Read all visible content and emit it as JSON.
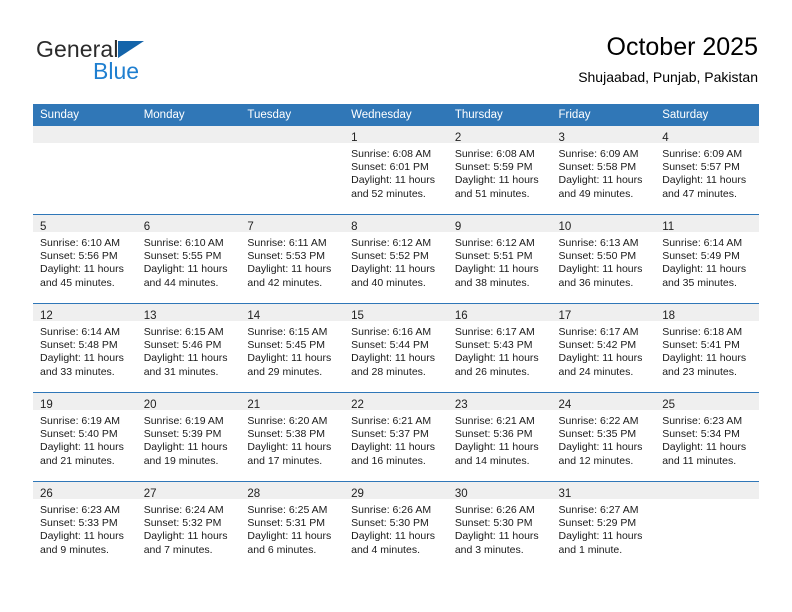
{
  "brand": {
    "name_top": "General",
    "name_bottom": "Blue",
    "triangle_color": "#1464aa",
    "blue_text_color": "#1f7fd0"
  },
  "header": {
    "title": "October 2025",
    "subtitle": "Shujaabad, Punjab, Pakistan",
    "accent_color": "#3077b7",
    "band_color": "#efefef"
  },
  "calendar": {
    "weekday_headers": [
      "Sunday",
      "Monday",
      "Tuesday",
      "Wednesday",
      "Thursday",
      "Friday",
      "Saturday"
    ],
    "weeks": [
      [
        {
          "day": "",
          "empty": true
        },
        {
          "day": "",
          "empty": true
        },
        {
          "day": "",
          "empty": true
        },
        {
          "day": "1",
          "sunrise": "Sunrise: 6:08 AM",
          "sunset": "Sunset: 6:01 PM",
          "daylight1": "Daylight: 11 hours",
          "daylight2": "and 52 minutes."
        },
        {
          "day": "2",
          "sunrise": "Sunrise: 6:08 AM",
          "sunset": "Sunset: 5:59 PM",
          "daylight1": "Daylight: 11 hours",
          "daylight2": "and 51 minutes."
        },
        {
          "day": "3",
          "sunrise": "Sunrise: 6:09 AM",
          "sunset": "Sunset: 5:58 PM",
          "daylight1": "Daylight: 11 hours",
          "daylight2": "and 49 minutes."
        },
        {
          "day": "4",
          "sunrise": "Sunrise: 6:09 AM",
          "sunset": "Sunset: 5:57 PM",
          "daylight1": "Daylight: 11 hours",
          "daylight2": "and 47 minutes."
        }
      ],
      [
        {
          "day": "5",
          "sunrise": "Sunrise: 6:10 AM",
          "sunset": "Sunset: 5:56 PM",
          "daylight1": "Daylight: 11 hours",
          "daylight2": "and 45 minutes."
        },
        {
          "day": "6",
          "sunrise": "Sunrise: 6:10 AM",
          "sunset": "Sunset: 5:55 PM",
          "daylight1": "Daylight: 11 hours",
          "daylight2": "and 44 minutes."
        },
        {
          "day": "7",
          "sunrise": "Sunrise: 6:11 AM",
          "sunset": "Sunset: 5:53 PM",
          "daylight1": "Daylight: 11 hours",
          "daylight2": "and 42 minutes."
        },
        {
          "day": "8",
          "sunrise": "Sunrise: 6:12 AM",
          "sunset": "Sunset: 5:52 PM",
          "daylight1": "Daylight: 11 hours",
          "daylight2": "and 40 minutes."
        },
        {
          "day": "9",
          "sunrise": "Sunrise: 6:12 AM",
          "sunset": "Sunset: 5:51 PM",
          "daylight1": "Daylight: 11 hours",
          "daylight2": "and 38 minutes."
        },
        {
          "day": "10",
          "sunrise": "Sunrise: 6:13 AM",
          "sunset": "Sunset: 5:50 PM",
          "daylight1": "Daylight: 11 hours",
          "daylight2": "and 36 minutes."
        },
        {
          "day": "11",
          "sunrise": "Sunrise: 6:14 AM",
          "sunset": "Sunset: 5:49 PM",
          "daylight1": "Daylight: 11 hours",
          "daylight2": "and 35 minutes."
        }
      ],
      [
        {
          "day": "12",
          "sunrise": "Sunrise: 6:14 AM",
          "sunset": "Sunset: 5:48 PM",
          "daylight1": "Daylight: 11 hours",
          "daylight2": "and 33 minutes."
        },
        {
          "day": "13",
          "sunrise": "Sunrise: 6:15 AM",
          "sunset": "Sunset: 5:46 PM",
          "daylight1": "Daylight: 11 hours",
          "daylight2": "and 31 minutes."
        },
        {
          "day": "14",
          "sunrise": "Sunrise: 6:15 AM",
          "sunset": "Sunset: 5:45 PM",
          "daylight1": "Daylight: 11 hours",
          "daylight2": "and 29 minutes."
        },
        {
          "day": "15",
          "sunrise": "Sunrise: 6:16 AM",
          "sunset": "Sunset: 5:44 PM",
          "daylight1": "Daylight: 11 hours",
          "daylight2": "and 28 minutes."
        },
        {
          "day": "16",
          "sunrise": "Sunrise: 6:17 AM",
          "sunset": "Sunset: 5:43 PM",
          "daylight1": "Daylight: 11 hours",
          "daylight2": "and 26 minutes."
        },
        {
          "day": "17",
          "sunrise": "Sunrise: 6:17 AM",
          "sunset": "Sunset: 5:42 PM",
          "daylight1": "Daylight: 11 hours",
          "daylight2": "and 24 minutes."
        },
        {
          "day": "18",
          "sunrise": "Sunrise: 6:18 AM",
          "sunset": "Sunset: 5:41 PM",
          "daylight1": "Daylight: 11 hours",
          "daylight2": "and 23 minutes."
        }
      ],
      [
        {
          "day": "19",
          "sunrise": "Sunrise: 6:19 AM",
          "sunset": "Sunset: 5:40 PM",
          "daylight1": "Daylight: 11 hours",
          "daylight2": "and 21 minutes."
        },
        {
          "day": "20",
          "sunrise": "Sunrise: 6:19 AM",
          "sunset": "Sunset: 5:39 PM",
          "daylight1": "Daylight: 11 hours",
          "daylight2": "and 19 minutes."
        },
        {
          "day": "21",
          "sunrise": "Sunrise: 6:20 AM",
          "sunset": "Sunset: 5:38 PM",
          "daylight1": "Daylight: 11 hours",
          "daylight2": "and 17 minutes."
        },
        {
          "day": "22",
          "sunrise": "Sunrise: 6:21 AM",
          "sunset": "Sunset: 5:37 PM",
          "daylight1": "Daylight: 11 hours",
          "daylight2": "and 16 minutes."
        },
        {
          "day": "23",
          "sunrise": "Sunrise: 6:21 AM",
          "sunset": "Sunset: 5:36 PM",
          "daylight1": "Daylight: 11 hours",
          "daylight2": "and 14 minutes."
        },
        {
          "day": "24",
          "sunrise": "Sunrise: 6:22 AM",
          "sunset": "Sunset: 5:35 PM",
          "daylight1": "Daylight: 11 hours",
          "daylight2": "and 12 minutes."
        },
        {
          "day": "25",
          "sunrise": "Sunrise: 6:23 AM",
          "sunset": "Sunset: 5:34 PM",
          "daylight1": "Daylight: 11 hours",
          "daylight2": "and 11 minutes."
        }
      ],
      [
        {
          "day": "26",
          "sunrise": "Sunrise: 6:23 AM",
          "sunset": "Sunset: 5:33 PM",
          "daylight1": "Daylight: 11 hours",
          "daylight2": "and 9 minutes."
        },
        {
          "day": "27",
          "sunrise": "Sunrise: 6:24 AM",
          "sunset": "Sunset: 5:32 PM",
          "daylight1": "Daylight: 11 hours",
          "daylight2": "and 7 minutes."
        },
        {
          "day": "28",
          "sunrise": "Sunrise: 6:25 AM",
          "sunset": "Sunset: 5:31 PM",
          "daylight1": "Daylight: 11 hours",
          "daylight2": "and 6 minutes."
        },
        {
          "day": "29",
          "sunrise": "Sunrise: 6:26 AM",
          "sunset": "Sunset: 5:30 PM",
          "daylight1": "Daylight: 11 hours",
          "daylight2": "and 4 minutes."
        },
        {
          "day": "30",
          "sunrise": "Sunrise: 6:26 AM",
          "sunset": "Sunset: 5:30 PM",
          "daylight1": "Daylight: 11 hours",
          "daylight2": "and 3 minutes."
        },
        {
          "day": "31",
          "sunrise": "Sunrise: 6:27 AM",
          "sunset": "Sunset: 5:29 PM",
          "daylight1": "Daylight: 11 hours",
          "daylight2": "and 1 minute."
        },
        {
          "day": "",
          "empty": true
        }
      ]
    ]
  }
}
